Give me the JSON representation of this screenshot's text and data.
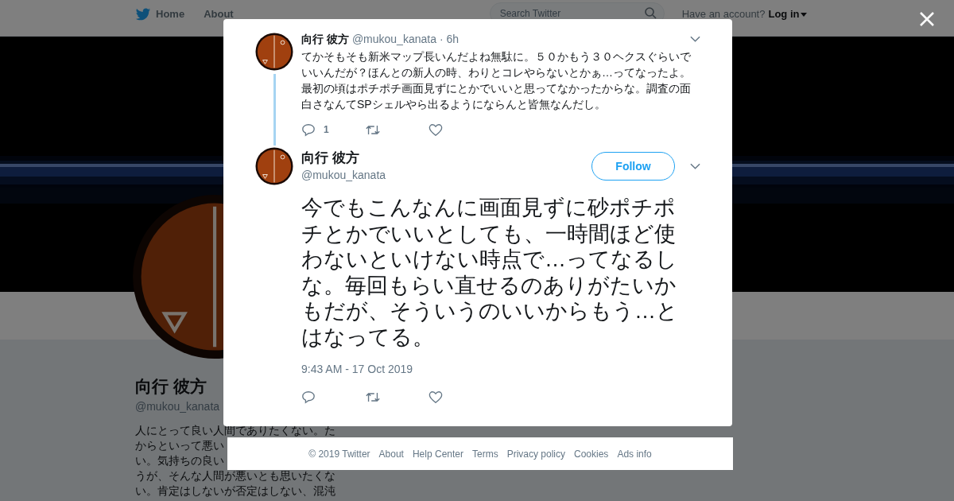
{
  "header": {
    "nav": [
      {
        "label": "Home",
        "kind": "home"
      },
      {
        "label": "About",
        "kind": "plain"
      }
    ],
    "search": {
      "placeholder": "Search Twitter"
    },
    "account_prompt": "Have an account?",
    "login": "Log in"
  },
  "profile": {
    "name": "向行 彼方",
    "handle": "@mukou_kanata",
    "bio_lines": [
      "人にとって良い人間でありたくない。た",
      "からといって悪い",
      "い。気持ちの良い",
      "うが、そんな人間が悪いとも思いたくな",
      "い。肯定はしないが否定はしない、混沌"
    ]
  },
  "modal": {
    "parent_tweet": {
      "name": "向行 彼方",
      "handle": "@mukou_kanata",
      "time": "· 6h",
      "text": "てかそもそも新米マップ長いんだよね無駄に。５０かもう３０ヘクスぐらいでいいんだが？ほんとの新人の時、わりとコレやらないとかぁ…ってなったよ。最初の頃はポチポチ画面見ずにとかでいいと思ってなかったからな。調査の面白さなんてSPシェルやら出るようにならんと皆無なんだし。",
      "reply_count": "1"
    },
    "tweet": {
      "name": "向行 彼方",
      "handle": "@mukou_kanata",
      "follow": "Follow",
      "text": "今でもこんなんに画面見ずに砂ポチポチとかでいいとしても、一時間ほど使わないといけない時点で…ってなるしな。毎回もらい直せるのありがたいかもだが、そういうのいいからもう…とはなってる。",
      "timestamp": "9:43 AM - 17 Oct 2019"
    }
  },
  "footer": [
    "© 2019 Twitter",
    "About",
    "Help Center",
    "Terms",
    "Privacy policy",
    "Cookies",
    "Ads info"
  ]
}
